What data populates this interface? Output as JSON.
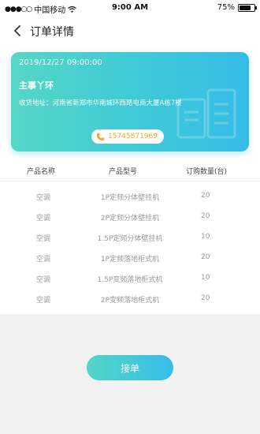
{
  "status_bar": {
    "carrier": "中国移动",
    "time": "9:00 AM",
    "battery": "75%",
    "battery_level": 0.75,
    "wifi_icon": "wifi-icon"
  },
  "nav": {
    "title": "订单详情",
    "back_icon": "chevron-left-icon"
  },
  "order": {
    "date": "2019/12/27 09:00:00",
    "name": "主事丫环",
    "address_label": "收货地址：",
    "address": "河南省新郑市华南城环西路电商大厦A栋7楼",
    "phone": "15745871969",
    "phone_icon": "phone-icon"
  },
  "table": {
    "headers": [
      "产品名称",
      "产品型号",
      "订购数量(台)"
    ],
    "rows": [
      [
        "空调",
        "1P定频分体壁挂机",
        "20"
      ],
      [
        "空调",
        "2P定频分体壁挂机",
        "20"
      ],
      [
        "空调",
        "1.5P定频分体壁挂机",
        "10"
      ],
      [
        "空调",
        "1P定频落地柜式机",
        "20"
      ],
      [
        "空调",
        "1.5P变频落地柜式机",
        "10"
      ],
      [
        "空调",
        "2P变频落地柜式机",
        "20"
      ]
    ]
  },
  "action": {
    "button_label": "接单"
  },
  "colors": {
    "accent_start": "#53d6c6",
    "accent_end": "#36bde8",
    "phone_text": "#f5a623"
  }
}
